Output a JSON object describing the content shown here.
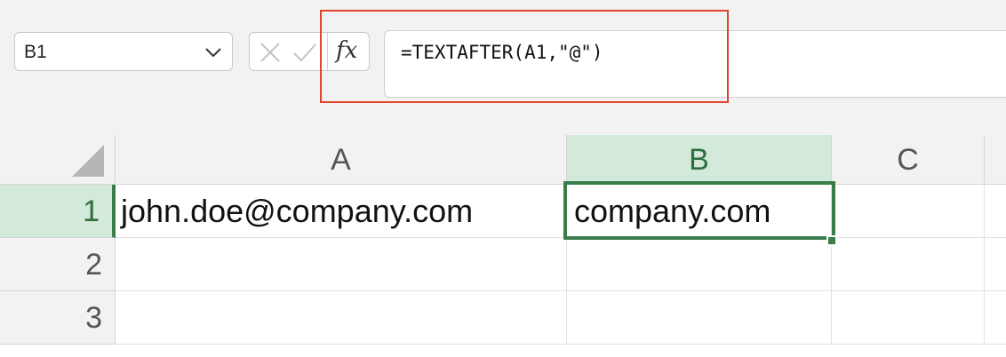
{
  "formula_bar": {
    "name_box": "B1",
    "formula": "=TEXTAFTER(A1,\"@\")",
    "fx_label": "fx"
  },
  "columns": [
    "A",
    "B",
    "C"
  ],
  "rows": [
    "1",
    "2",
    "3"
  ],
  "cells": {
    "A1": "john.doe@company.com",
    "B1": "company.com"
  },
  "colors": {
    "selection": "#3a7d4b",
    "selection_header_bg": "#d3eadb",
    "highlight_box": "#e0452b"
  },
  "icons": [
    "chevron-down-icon",
    "cancel-icon",
    "enter-icon",
    "function-icon",
    "select-all-icon",
    "fill-handle-icon"
  ]
}
